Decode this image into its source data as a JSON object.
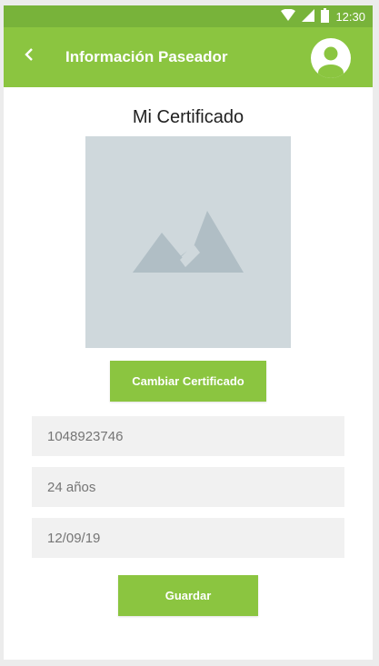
{
  "status_bar": {
    "time": "12:30",
    "icons": [
      "wifi-icon",
      "signal-icon",
      "battery-icon"
    ]
  },
  "app_bar": {
    "title": "Información Paseador",
    "back_icon": "chevron-left-icon",
    "profile_icon": "account-circle-icon"
  },
  "certificate": {
    "heading": "Mi Certificado",
    "image_placeholder_icon": "image-placeholder-icon",
    "change_button_label": "Cambiar Certificado"
  },
  "form": {
    "id_number": "1048923746",
    "age": "24 años",
    "date": "12/09/19"
  },
  "actions": {
    "save_label": "Guardar"
  },
  "colors": {
    "primary": "#8bc540",
    "status_bar": "#78b33a",
    "image_placeholder": "#cfd8dc",
    "field_background": "#f1f1f1"
  }
}
